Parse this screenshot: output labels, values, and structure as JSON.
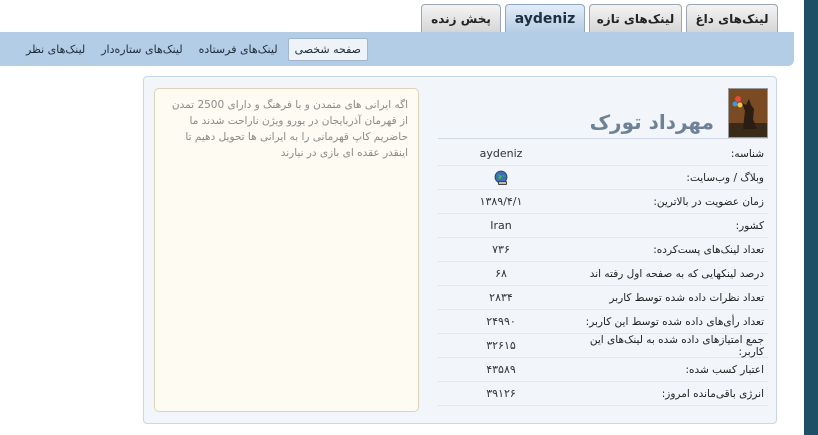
{
  "tabs": [
    {
      "label": "لینک‌های داغ",
      "active": false
    },
    {
      "label": "لینک‌های تازه",
      "active": false
    },
    {
      "label": "aydeniz",
      "active": true
    },
    {
      "label": "پخش زنده",
      "active": false
    }
  ],
  "subnav": [
    {
      "label": "صفحه شخصی",
      "active": true
    },
    {
      "label": "لینک‌های فرستاده",
      "active": false
    },
    {
      "label": "لینک‌های ستاره‌دار",
      "active": false
    },
    {
      "label": "لینک‌های نظر",
      "active": false
    }
  ],
  "profile": {
    "name": "مهرداد تورک",
    "rows": [
      {
        "label": "شناسه:",
        "value": "aydeniz"
      },
      {
        "label": "وبلاگ / وب‌سایت:",
        "value": "",
        "icon": "globe-link-icon"
      },
      {
        "label": "زمان عضویت در بالاترین:",
        "value": "۱۳۸۹/۴/۱"
      },
      {
        "label": "کشور:",
        "value": "Iran"
      },
      {
        "label": "تعداد لینک‌های پست‌کرده:",
        "value": "۷۳۶"
      },
      {
        "label": "درصد لینکهایی که به صفحه اول رفته اند",
        "value": "۶۸"
      },
      {
        "label": "تعداد نظرات داده شده توسط کاربر",
        "value": "۲۸۳۴"
      },
      {
        "label": "تعداد رأی‌های داده شده توسط این کاربر:",
        "value": "۲۴۹۹۰"
      },
      {
        "label": "جمع امتیازهای داده شده به لینک‌های این کاربر:",
        "value": "۳۲۶۱۵"
      },
      {
        "label": "اعتبار کسب شده:",
        "value": "۴۳۵۸۹"
      },
      {
        "label": "انرژی باقی‌مانده امروز:",
        "value": "۳۹۱۲۶"
      }
    ]
  },
  "bio": "اگه ایرانی های متمدن و با فرهنگ و دارای 2500 تمدن از قهرمان آذربایجان در یورو ویژن ناراحت شدند ما حاضریم کاپ قهرمانی را به ایرانی ها تحویل دهیم تا اینقدر عقده ای بازی در نیارند",
  "colors": {
    "subnav_bg": "#b3cde6",
    "active_tab": "#b6cde4",
    "side_bar": "#1f4f66"
  }
}
